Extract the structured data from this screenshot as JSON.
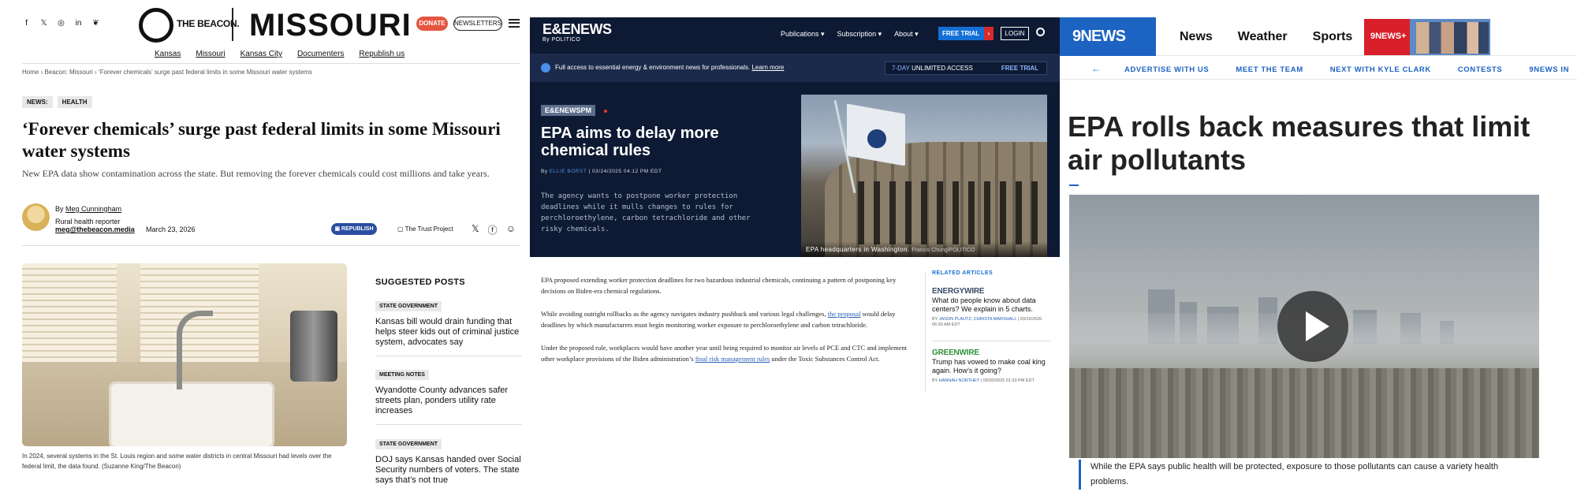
{
  "beacon": {
    "social_icons": [
      "facebook-icon",
      "x-icon",
      "instagram-icon",
      "linkedin-icon",
      "bluesky-icon"
    ],
    "logo_text": "THE BEACON.",
    "state": "MISSOURI",
    "donate": "DONATE",
    "newsletters": "NEWSLETTERS",
    "nav": [
      "Kansas",
      "Missouri",
      "Kansas City",
      "Documenters",
      "Republish us"
    ],
    "breadcrumb": "Home › Beacon: Missouri › ‘Forever chemicals’ surge past federal limits in some Missouri water systems",
    "tags": [
      "NEWS:",
      "HEALTH"
    ],
    "headline": "‘Forever chemicals’ surge past federal limits in some Missouri water systems",
    "dek": "New EPA data show contamination across the state. But removing the forever chemicals could cost millions and take years.",
    "by_prefix": "By",
    "author": "Meg Cunningham",
    "author_role": "Rural health reporter",
    "author_email": "meg@thebeacon.media",
    "date": "March 23, 2026",
    "republish": "REPUBLISH",
    "trust": "The Trust Project",
    "photo_caption": "In 2024, several systems in the St. Louis region and some water districts in central Missouri had levels over the federal limit, the data found. (Suzanne King/The Beacon)",
    "suggested_title": "SUGGESTED POSTS",
    "suggested": [
      {
        "category": "STATE GOVERNMENT",
        "title": "Kansas bill would drain funding that helps steer kids out of criminal justice system, advocates say"
      },
      {
        "category": "MEETING NOTES",
        "title": "Wyandotte County advances safer streets plan, ponders utility rate increases"
      },
      {
        "category": "STATE GOVERNMENT",
        "title": "DOJ says Kansas handed over Social Security numbers of voters. The state says that’s not true"
      }
    ],
    "colors": {
      "donate": "#e4553f",
      "republish": "#2b4ea2"
    }
  },
  "ee": {
    "logo": "E&ENEWS",
    "logo_sub": "By POLITICO",
    "menu": [
      "Publications ▾",
      "Subscription ▾",
      "About ▾"
    ],
    "free_trial": "FREE TRIAL",
    "login": "LOGIN",
    "bar_text": "Full access to essential energy & environment news for professionals.",
    "bar_link": "Learn more",
    "access_prefix": "7-DAY",
    "access_text": "UNLIMITED ACCESS",
    "access_trial": "FREE TRIAL",
    "section_badge": "E&ENEWSPM",
    "headline": "EPA aims to delay more chemical rules",
    "byline_prefix": "By",
    "byline_author": "ELLIE BORST",
    "byline_date": "| 03/24/2025 04:12 PM EDT",
    "dek": "The agency wants to postpone worker protection deadlines while it mulls changes to rules for perchloroethylene, carbon tetrachloride and other risky chemicals.",
    "photo_caption": "EPA headquarters in Washington.",
    "photo_credit": "Francis Chung/POLITICO",
    "body": {
      "p1": "EPA proposed extending worker protection deadlines for two hazardous industrial chemicals, continuing a pattern of postponing key decisions on Biden-era chemical regulations.",
      "p2_a": "While avoiding outright rollbacks as the agency navigates industry pushback and various legal challenges,",
      "p2_link": "the proposal",
      "p2_b": "would delay deadlines by which manufacturers must begin monitoring worker exposure to perchloroethylene and carbon tetrachloride.",
      "p3_a": "Under the proposed rule, workplaces would have another year until being required to monitor air levels of PCE and CTC and implement other workplace provisions of the Biden administration’s",
      "p3_link": "final risk management rules",
      "p3_b": "under the Toxic Substances Control Act."
    },
    "related_title": "RELATED ARTICLES",
    "related": [
      {
        "brand": "ENERGYWIRE",
        "title": "What do people know about data centers? We explain in 5 charts.",
        "authors": "JASON PLAUTZ, CHRISTA MARSHALL",
        "meta": "| 03/19/2026 06:30 AM EDT",
        "brand_color": "#3a4a66"
      },
      {
        "brand": "GREENWIRE",
        "title": "Trump has vowed to make coal king again. How’s it going?",
        "authors": "HANNAH NORTHEY",
        "meta": "| 03/20/2025 01:33 PM EDT",
        "brand_color": "#2f8f3a"
      }
    ],
    "colors": {
      "bg": "#0e1a33",
      "accent": "#1470d6"
    }
  },
  "ninenews": {
    "logo": "9NEWS",
    "nav": [
      "News",
      "Weather",
      "Sports"
    ],
    "plus": "9NEWS+",
    "subnav": [
      "ADVERTISE WITH US",
      "MEET THE TEAM",
      "NEXT WITH KYLE CLARK",
      "CONTESTS",
      "9NEWS IN"
    ],
    "headline": "EPA rolls back measures that limit air pollutants",
    "caption": "While the EPA says public health will be protected, exposure to those pollutants can cause a variety health problems.",
    "colors": {
      "brand": "#1c63c2",
      "plus": "#d81f2a"
    }
  }
}
